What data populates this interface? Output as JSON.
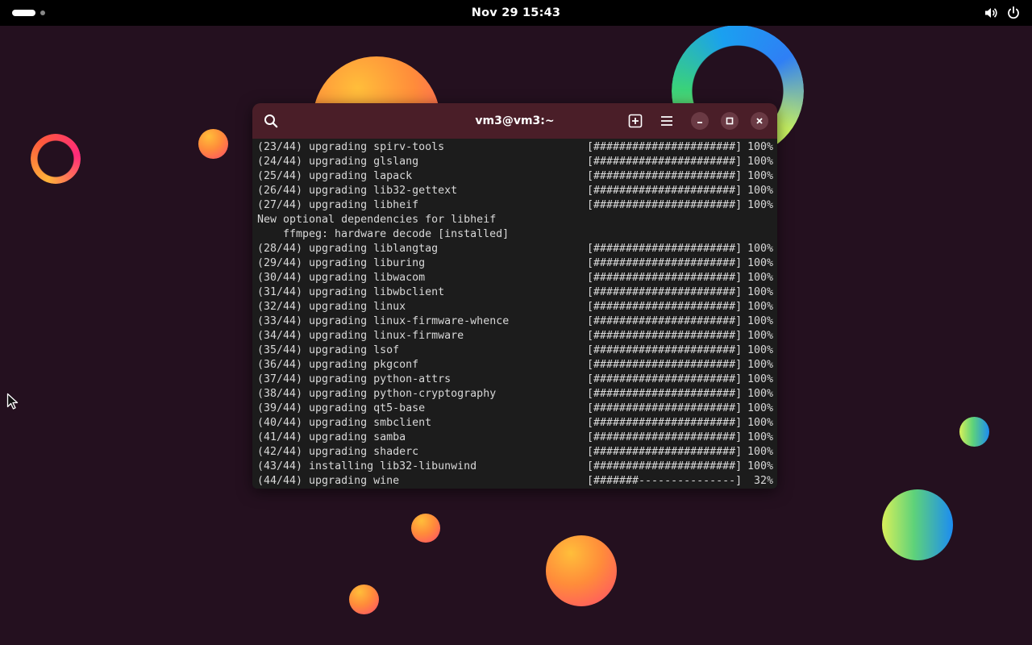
{
  "topbar": {
    "clock": "Nov 29  15:43"
  },
  "terminal": {
    "title": "vm3@vm3:~",
    "lines": [
      {
        "text": "(23/44) upgrading spirv-tools",
        "bar": "[######################]",
        "pct": "100%"
      },
      {
        "text": "(24/44) upgrading glslang",
        "bar": "[######################]",
        "pct": "100%"
      },
      {
        "text": "(25/44) upgrading lapack",
        "bar": "[######################]",
        "pct": "100%"
      },
      {
        "text": "(26/44) upgrading lib32-gettext",
        "bar": "[######################]",
        "pct": "100%"
      },
      {
        "text": "(27/44) upgrading libheif",
        "bar": "[######################]",
        "pct": "100%"
      },
      {
        "text": "New optional dependencies for libheif"
      },
      {
        "text": "ffmpeg: hardware decode [installed]",
        "indent": true
      },
      {
        "text": "(28/44) upgrading liblangtag",
        "bar": "[######################]",
        "pct": "100%"
      },
      {
        "text": "(29/44) upgrading liburing",
        "bar": "[######################]",
        "pct": "100%"
      },
      {
        "text": "(30/44) upgrading libwacom",
        "bar": "[######################]",
        "pct": "100%"
      },
      {
        "text": "(31/44) upgrading libwbclient",
        "bar": "[######################]",
        "pct": "100%"
      },
      {
        "text": "(32/44) upgrading linux",
        "bar": "[######################]",
        "pct": "100%"
      },
      {
        "text": "(33/44) upgrading linux-firmware-whence",
        "bar": "[######################]",
        "pct": "100%"
      },
      {
        "text": "(34/44) upgrading linux-firmware",
        "bar": "[######################]",
        "pct": "100%"
      },
      {
        "text": "(35/44) upgrading lsof",
        "bar": "[######################]",
        "pct": "100%"
      },
      {
        "text": "(36/44) upgrading pkgconf",
        "bar": "[######################]",
        "pct": "100%"
      },
      {
        "text": "(37/44) upgrading python-attrs",
        "bar": "[######################]",
        "pct": "100%"
      },
      {
        "text": "(38/44) upgrading python-cryptography",
        "bar": "[######################]",
        "pct": "100%"
      },
      {
        "text": "(39/44) upgrading qt5-base",
        "bar": "[######################]",
        "pct": "100%"
      },
      {
        "text": "(40/44) upgrading smbclient",
        "bar": "[######################]",
        "pct": "100%"
      },
      {
        "text": "(41/44) upgrading samba",
        "bar": "[######################]",
        "pct": "100%"
      },
      {
        "text": "(42/44) upgrading shaderc",
        "bar": "[######################]",
        "pct": "100%"
      },
      {
        "text": "(43/44) installing lib32-libunwind",
        "bar": "[######################]",
        "pct": "100%"
      },
      {
        "text": "(44/44) upgrading wine",
        "bar": "[#######---------------]",
        "pct": "32%"
      }
    ]
  },
  "colors": {
    "desktop_bg": "#24101f",
    "headerbar": "#4a1e28",
    "terminal_bg": "#1c1c1c",
    "terminal_fg": "#d8d8d8"
  },
  "icons": [
    "activities-indicator",
    "volume-icon",
    "power-icon",
    "search-icon",
    "new-tab-icon",
    "hamburger-menu-icon",
    "minimize-icon",
    "maximize-icon",
    "close-icon",
    "mouse-pointer-icon"
  ]
}
